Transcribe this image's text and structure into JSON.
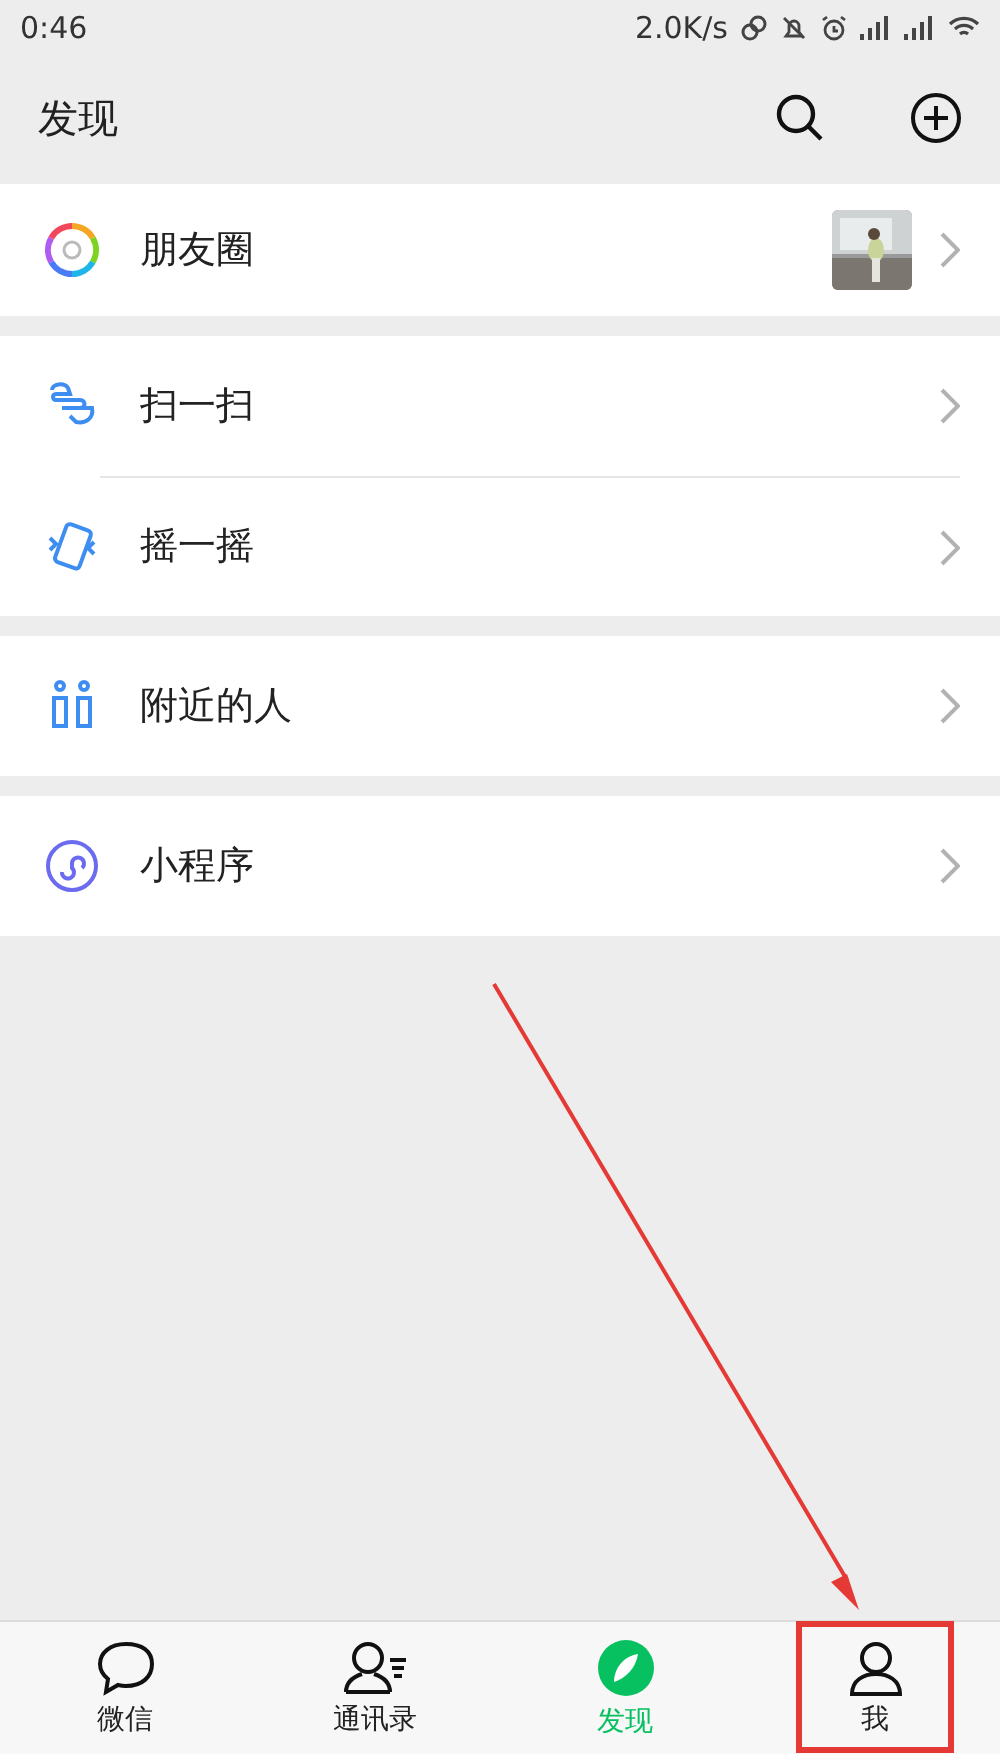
{
  "status_bar": {
    "time": "0:46",
    "speed": "2.0K/s"
  },
  "header": {
    "title": "发现"
  },
  "groups": [
    {
      "items": [
        {
          "label": "朋友圈",
          "kind": "moments"
        }
      ]
    },
    {
      "items": [
        {
          "label": "扫一扫",
          "kind": "scan"
        },
        {
          "label": "摇一摇",
          "kind": "shake"
        }
      ]
    },
    {
      "items": [
        {
          "label": "附近的人",
          "kind": "nearby"
        }
      ]
    },
    {
      "items": [
        {
          "label": "小程序",
          "kind": "miniprogram"
        }
      ]
    }
  ],
  "tabs": [
    {
      "label": "微信",
      "kind": "chat",
      "selected": false
    },
    {
      "label": "通讯录",
      "kind": "contacts",
      "selected": false
    },
    {
      "label": "发现",
      "kind": "discover",
      "selected": true
    },
    {
      "label": "我",
      "kind": "me",
      "selected": false
    }
  ],
  "annotation": {
    "kind": "arrow"
  }
}
